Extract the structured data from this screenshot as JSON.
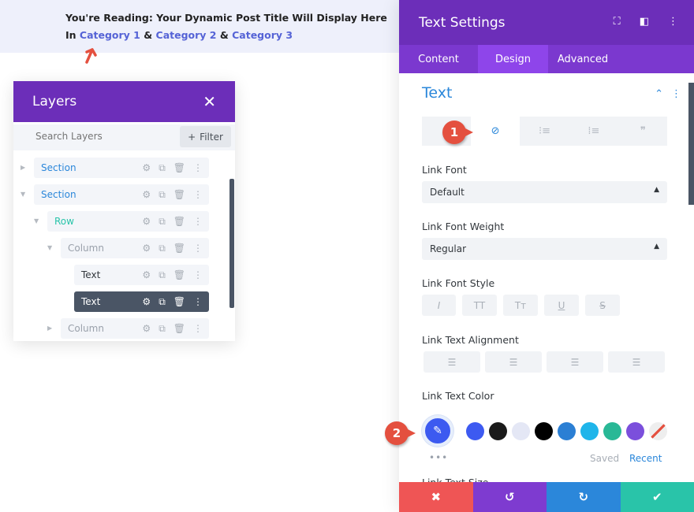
{
  "banner": {
    "line1": "You're Reading: Your Dynamic Post Title Will Display Here",
    "in": "In",
    "cat1": "Category 1",
    "amp": "&",
    "cat2": "Category 2",
    "cat3": "Category 3"
  },
  "layers": {
    "title": "Layers",
    "close": "✕",
    "search_placeholder": "Search Layers",
    "filter": "Filter",
    "filter_icon": "+",
    "rows": [
      {
        "label": "Section"
      },
      {
        "label": "Section"
      },
      {
        "label": "Row"
      },
      {
        "label": "Column"
      },
      {
        "label": "Text"
      },
      {
        "label": "Text"
      },
      {
        "label": "Column"
      }
    ]
  },
  "panel": {
    "title": "Text Settings",
    "tabs": [
      "Content",
      "Design",
      "Advanced"
    ],
    "active_tab": "Design",
    "section": "Text",
    "link_font": {
      "label": "Link Font",
      "value": "Default"
    },
    "link_weight": {
      "label": "Link Font Weight",
      "value": "Regular"
    },
    "link_style": {
      "label": "Link Font Style",
      "options": [
        "I",
        "TT",
        "Tт",
        "U",
        "S"
      ]
    },
    "link_align": {
      "label": "Link Text Alignment"
    },
    "link_color": {
      "label": "Link Text Color",
      "swatches": [
        "#3d5af1",
        "#1a1a1a",
        "#e4e7f5",
        "#000000",
        "#2b7fd4",
        "#1fb5ea",
        "#29b896",
        "#7b4fdc"
      ],
      "saved": "Saved",
      "recent": "Recent",
      "more": "•••"
    },
    "next_label": "Link Text Size",
    "footer": {
      "cancel": "✖",
      "undo": "↺",
      "redo": "↻",
      "save": "✔"
    },
    "colors": {
      "purple": "#6c2eb9",
      "blue": "#2b87da",
      "red": "#ef5555",
      "green": "#29c4a9"
    }
  },
  "annotations": {
    "one": "1",
    "two": "2"
  }
}
